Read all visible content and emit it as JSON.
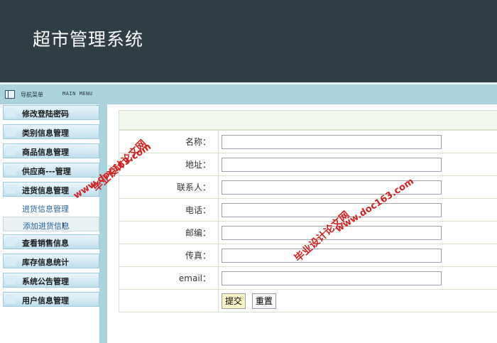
{
  "header": {
    "title": "超市管理系统"
  },
  "nav": {
    "title": "导航菜单",
    "title_en": "MAIN MENU",
    "icon": "menu-icon"
  },
  "sidebar": {
    "items": [
      {
        "label": "修改登陆密码"
      },
      {
        "label": "类别信息管理"
      },
      {
        "label": "商品信息管理"
      },
      {
        "label": "供应商---管理"
      },
      {
        "label": "进货信息管理"
      }
    ],
    "subitems": [
      {
        "label": "进货信息管理"
      },
      {
        "label": "添加进货信息"
      }
    ],
    "items_after": [
      {
        "label": "查看销售信息"
      },
      {
        "label": "库存信息统计"
      },
      {
        "label": "系统公告管理"
      },
      {
        "label": "用户信息管理"
      }
    ]
  },
  "form": {
    "fields": [
      {
        "label": "名称：",
        "value": ""
      },
      {
        "label": "地址：",
        "value": ""
      },
      {
        "label": "联系人：",
        "value": ""
      },
      {
        "label": "电话：",
        "value": ""
      },
      {
        "label": "邮编：",
        "value": ""
      },
      {
        "label": "传真：",
        "value": ""
      },
      {
        "label": "email：",
        "value": ""
      }
    ],
    "submit_label": "提交",
    "reset_label": "重置"
  },
  "watermarks": {
    "site": "www.doc163.com",
    "name": "毕业设计论文网",
    "color": "#d42020"
  }
}
